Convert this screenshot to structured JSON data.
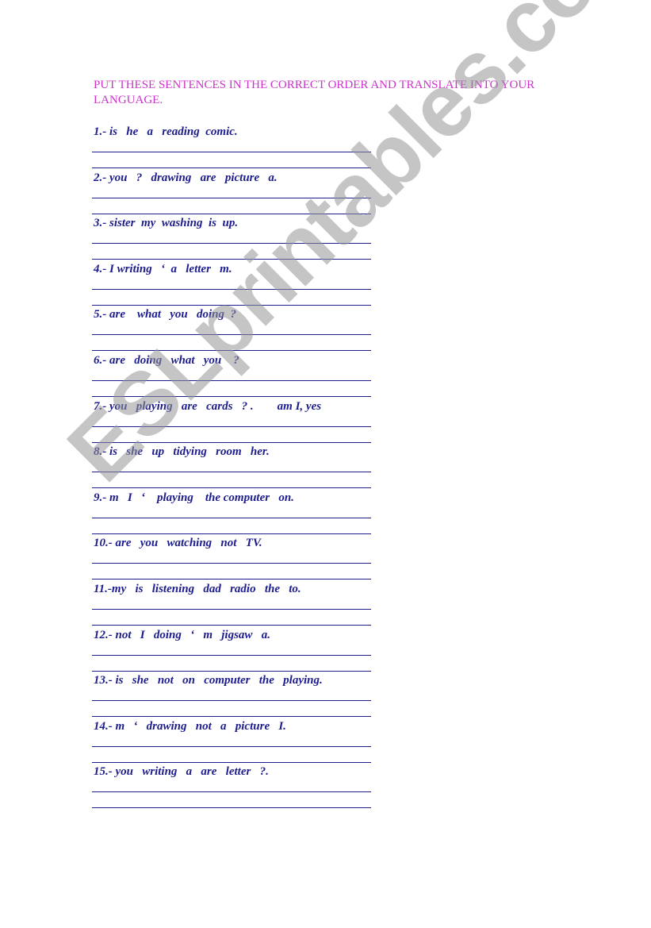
{
  "worksheet": {
    "title": "PUT THESE SENTENCES IN THE CORRECT ORDER AND TRANSLATE INTO YOUR LANGUAGE.",
    "items": [
      {
        "text": "1.- is   he   a   reading  comic."
      },
      {
        "text": "2.- you   ?   drawing   are   picture   a."
      },
      {
        "text": "3.- sister  my  washing  is  up."
      },
      {
        "text": "4.- I writing   ‘  a   letter   m."
      },
      {
        "text": "5.- are    what   you   doing  ?"
      },
      {
        "text": "6.- are   doing   what   you    ?"
      },
      {
        "text": "7.- you   playing   are   cards   ? .        am I, yes"
      },
      {
        "text": "8.- is   she   up   tidying   room   her."
      },
      {
        "text": "9.- m   I   ‘    playing    the computer   on."
      },
      {
        "text": "10.- are   you   watching   not   TV."
      },
      {
        "text": "11.-my   is   listening   dad   radio   the   to."
      },
      {
        "text": "12.- not   I   doing   ‘   m   jigsaw   a."
      },
      {
        "text": "13.- is   she   not   on   computer   the   playing."
      },
      {
        "text": "14.- m   ‘   drawing   not   a   picture   I."
      },
      {
        "text": "15.- you   writing   a   are   letter   ?."
      }
    ],
    "watermark": "ESLprintables.com"
  },
  "colors": {
    "title": "#cc33cc",
    "text": "#1c1c8e",
    "watermark": "#c0c0c0"
  }
}
